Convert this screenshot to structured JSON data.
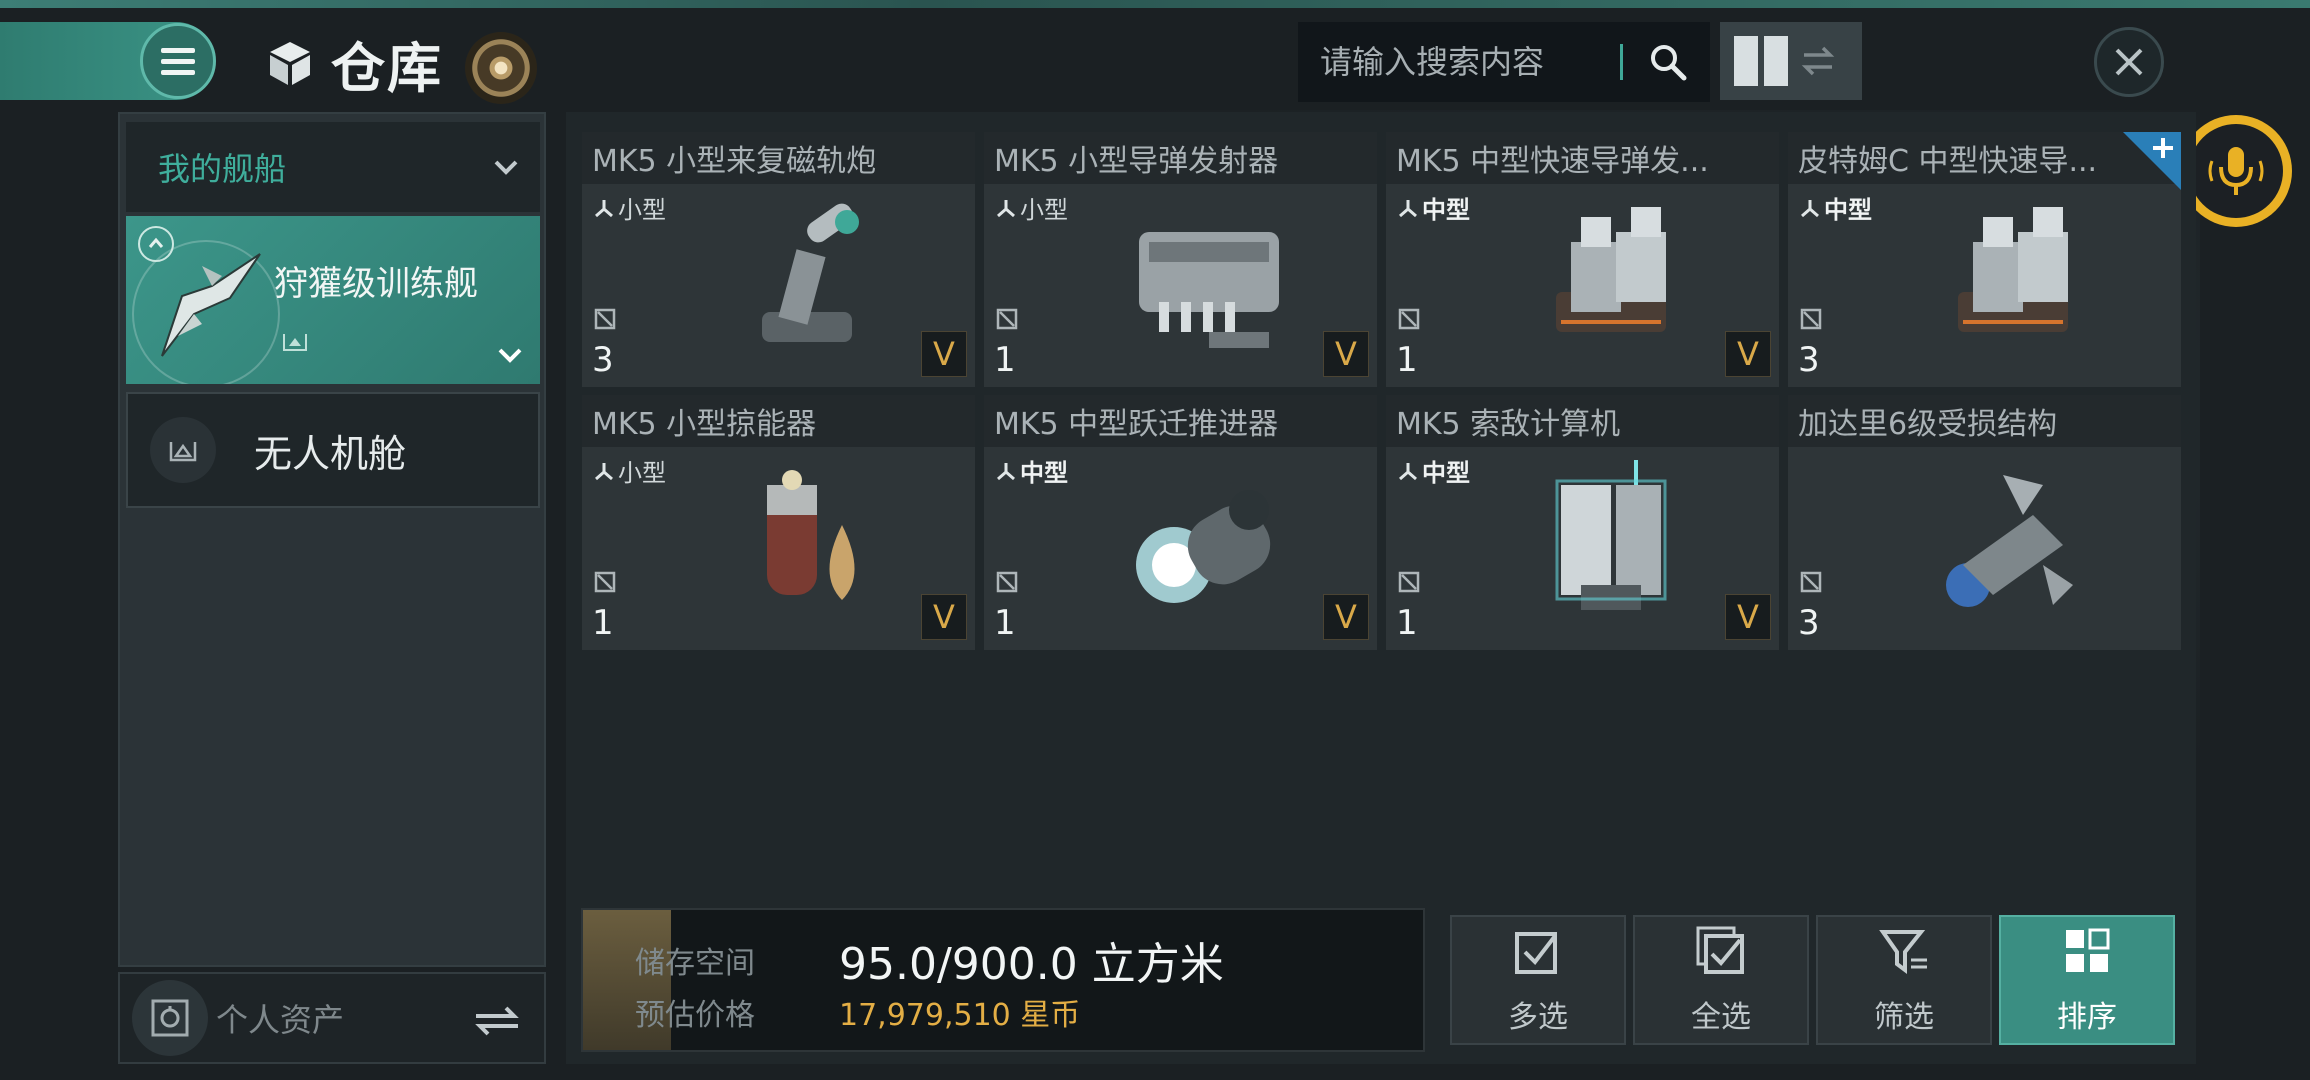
{
  "header": {
    "title": "仓库",
    "search_placeholder": "请输入搜索内容"
  },
  "sidebar": {
    "dropdown_label": "我的舰船",
    "ship_name": "狩獾级训练舰",
    "drone_bay_label": "无人机舱",
    "assets_label": "个人资产"
  },
  "items": [
    {
      "title": "MK5 小型来复磁轨炮",
      "size": "小型",
      "qty": "3",
      "v": "V",
      "icon": "railgun-icon"
    },
    {
      "title": "MK5 小型导弹发射器",
      "size": "小型",
      "qty": "1",
      "v": "V",
      "icon": "missile-launcher-icon"
    },
    {
      "title": "MK5 中型快速导弹发...",
      "size": "中型",
      "qty": "1",
      "v": "V",
      "icon": "rapid-missile-launcher-icon"
    },
    {
      "title": "皮特姆C 中型快速导...",
      "size": "中型",
      "qty": "3",
      "v": "",
      "icon": "rapid-missile-launcher-icon"
    },
    {
      "title": "MK5 小型掠能器",
      "size": "小型",
      "qty": "1",
      "v": "V",
      "icon": "energy-neutralizer-icon"
    },
    {
      "title": "MK5 中型跃迁推进器",
      "size": "中型",
      "qty": "1",
      "v": "V",
      "icon": "warp-thruster-icon"
    },
    {
      "title": "MK5 索敌计算机",
      "size": "中型",
      "qty": "1",
      "v": "V",
      "icon": "targeting-computer-icon"
    },
    {
      "title": "加达里6级受损结构",
      "size": "",
      "qty": "3",
      "v": "",
      "icon": "damaged-structure-icon"
    }
  ],
  "storage": {
    "space_label": "储存空间",
    "space_value": "95.0/900.0 立方米",
    "price_label": "预估价格",
    "price_value": "17,979,510 星币"
  },
  "actions": {
    "multi_select": "多选",
    "select_all": "全选",
    "filter": "筛选",
    "sort": "排序"
  },
  "colors": {
    "accent_teal": "#3a8e82",
    "gold": "#e3ae45",
    "voice_ring": "#e9b125"
  }
}
